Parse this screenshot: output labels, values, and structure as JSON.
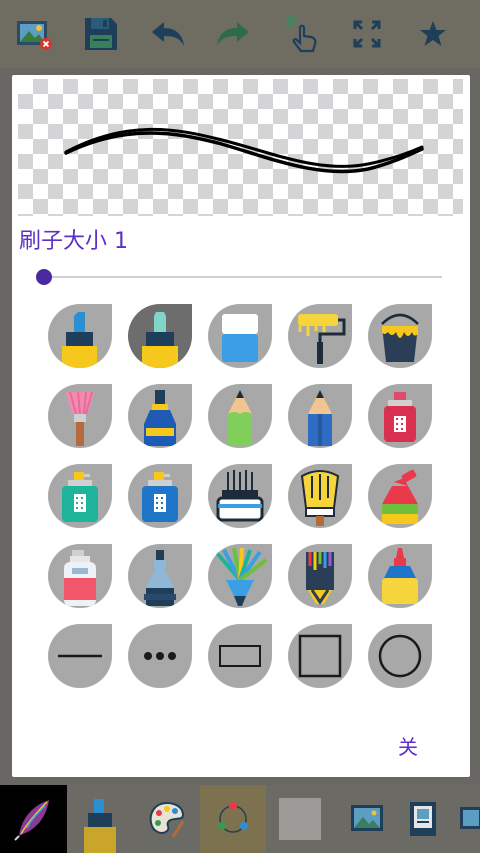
{
  "toolbar": {
    "buttons": [
      {
        "name": "image-delete-icon"
      },
      {
        "name": "save-icon"
      },
      {
        "name": "undo-icon"
      },
      {
        "name": "redo-icon"
      },
      {
        "name": "touch-move-icon"
      },
      {
        "name": "fullscreen-icon"
      },
      {
        "name": "star-icon"
      }
    ]
  },
  "dialog": {
    "size_label": "刷子大小 1",
    "brush_size": 1,
    "close_label": "关",
    "brushes": [
      {
        "name": "marker-brush",
        "selected": false
      },
      {
        "name": "highlighter-brush",
        "selected": true
      },
      {
        "name": "eraser-brush",
        "selected": false
      },
      {
        "name": "roller-brush",
        "selected": false
      },
      {
        "name": "paint-bucket-brush",
        "selected": false
      },
      {
        "name": "makeup-brush",
        "selected": false
      },
      {
        "name": "ink-bottle-brush",
        "selected": false
      },
      {
        "name": "pencil-green-brush",
        "selected": false
      },
      {
        "name": "pencil-blue-brush",
        "selected": false
      },
      {
        "name": "spray-red-brush",
        "selected": false
      },
      {
        "name": "spray-teal-brush",
        "selected": false
      },
      {
        "name": "spray-blue-brush",
        "selected": false
      },
      {
        "name": "wide-brush",
        "selected": false
      },
      {
        "name": "glove-brush",
        "selected": false
      },
      {
        "name": "tube-brush",
        "selected": false
      },
      {
        "name": "spray-can-brush",
        "selected": false
      },
      {
        "name": "bottle-brush",
        "selected": false
      },
      {
        "name": "rainbow-fan-brush",
        "selected": false
      },
      {
        "name": "rainbow-flat-brush",
        "selected": false
      },
      {
        "name": "glue-bottle-brush",
        "selected": false
      },
      {
        "name": "line-shape",
        "selected": false
      },
      {
        "name": "dots-shape",
        "selected": false
      },
      {
        "name": "rectangle-shape",
        "selected": false
      },
      {
        "name": "square-shape",
        "selected": false
      },
      {
        "name": "circle-shape",
        "selected": false
      }
    ]
  },
  "bottombar": {
    "items": [
      {
        "name": "feather-icon"
      },
      {
        "name": "brush-tool-icon"
      },
      {
        "name": "palette-icon"
      },
      {
        "name": "color-wheel-icon"
      },
      {
        "name": "color-swatch"
      },
      {
        "name": "image-icon"
      },
      {
        "name": "frame-icon"
      },
      {
        "name": "gallery-icon"
      }
    ]
  },
  "colors": {
    "accent": "#5c2fc7",
    "slider_thumb": "#4b2aa0",
    "brush_bg": "#a8a8a8",
    "brush_bg_selected": "#6d6d6d"
  }
}
